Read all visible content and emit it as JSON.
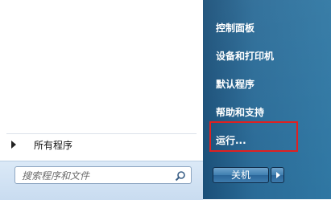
{
  "start_menu": {
    "all_programs": "所有程序",
    "search": {
      "placeholder": "搜索程序和文件"
    },
    "right_items": [
      "控制面板",
      "设备和打印机",
      "默认程序",
      "帮助和支持",
      "运行..."
    ],
    "shutdown_label": "关机"
  },
  "colors": {
    "right_pane": "#2a6b97",
    "highlight_box": "#e02020"
  }
}
